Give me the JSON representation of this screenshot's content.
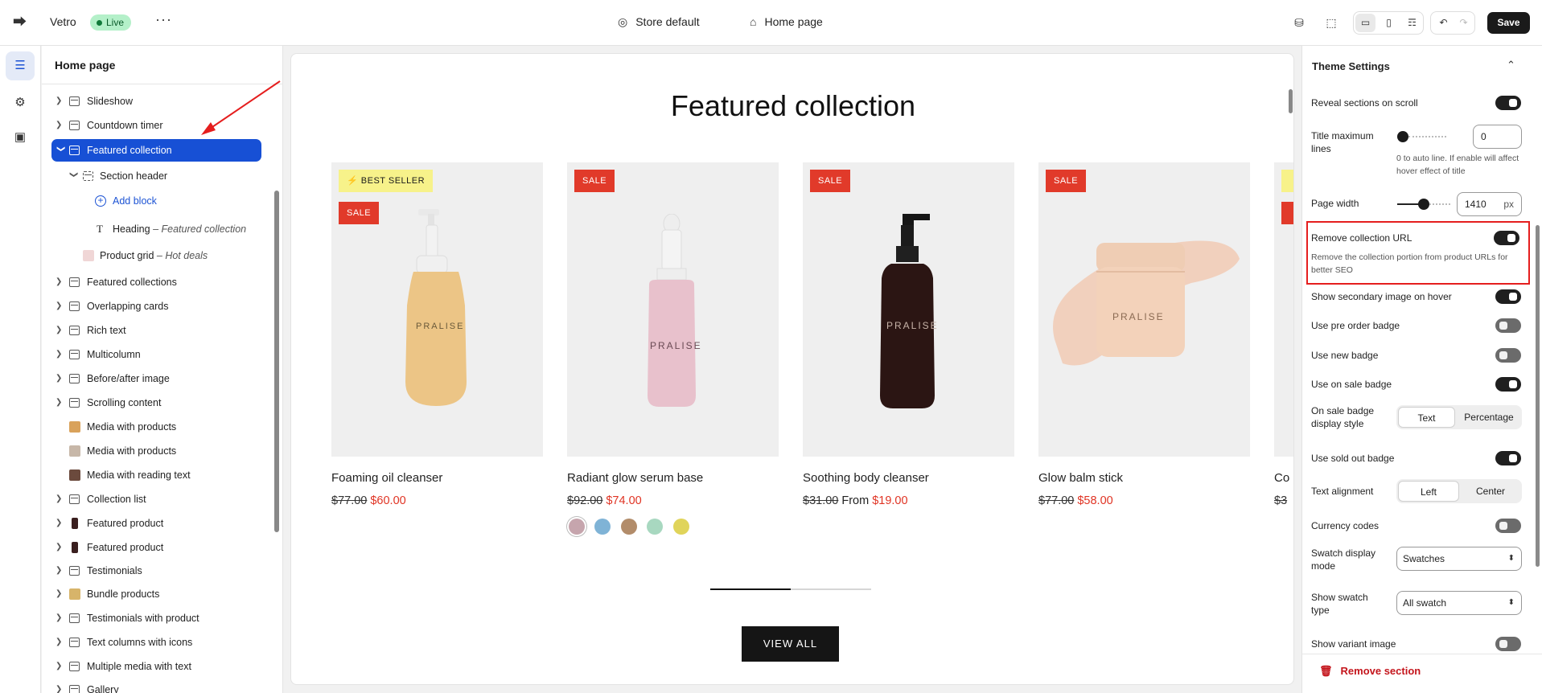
{
  "topbar": {
    "store_name": "Vetro",
    "status": "Live",
    "more": "···",
    "theme_label": "Store default",
    "page_label": "Home page",
    "save_label": "Save"
  },
  "sidebar": {
    "title": "Home page",
    "items": [
      {
        "label": "Slideshow"
      },
      {
        "label": "Countdown timer"
      },
      {
        "label": "Featured collection"
      },
      {
        "label": "Section header"
      },
      {
        "label": "Add block"
      },
      {
        "label": "Heading",
        "sub": "– Featured collection"
      },
      {
        "label": "Product grid",
        "sub": "– Hot deals"
      },
      {
        "label": "Featured collections"
      },
      {
        "label": "Overlapping cards"
      },
      {
        "label": "Rich text"
      },
      {
        "label": "Multicolumn"
      },
      {
        "label": "Before/after image"
      },
      {
        "label": "Scrolling content"
      },
      {
        "label": "Media with products"
      },
      {
        "label": "Media with products"
      },
      {
        "label": "Media with reading text"
      },
      {
        "label": "Collection list"
      },
      {
        "label": "Featured product"
      },
      {
        "label": "Featured product"
      },
      {
        "label": "Testimonials"
      },
      {
        "label": "Bundle products"
      },
      {
        "label": "Testimonials with product"
      },
      {
        "label": "Text columns with icons"
      },
      {
        "label": "Multiple media with text"
      },
      {
        "label": "Gallery"
      }
    ]
  },
  "preview": {
    "title": "Featured collection",
    "products": [
      {
        "name": "Foaming oil cleanser",
        "old_price": "$77.00",
        "price": "$60.00",
        "badges": [
          "BEST SELLER",
          "SALE"
        ],
        "brand": "PRALISE"
      },
      {
        "name": "Radiant glow serum base",
        "old_price": "$92.00",
        "price": "$74.00",
        "badges": [
          "SALE"
        ],
        "brand": "PRALISE",
        "swatches": [
          "#c6a5ad",
          "#7fb3d6",
          "#b28c6a",
          "#a8d8c0",
          "#e0d45a"
        ]
      },
      {
        "name": "Soothing body cleanser",
        "old_price": "$31.00",
        "from": "From",
        "price": "$19.00",
        "badges": [
          "SALE"
        ],
        "brand": "PRALISE"
      },
      {
        "name": "Glow balm stick",
        "old_price": "$77.00",
        "price": "$58.00",
        "badges": [
          "SALE"
        ],
        "brand": "PRALISE"
      },
      {
        "name": "Co",
        "old_price": "$3"
      }
    ],
    "view_all": "VIEW ALL",
    "slider_progress": 0.5
  },
  "settings": {
    "title": "Theme Settings",
    "reveal": {
      "label": "Reveal sections on scroll",
      "on": true
    },
    "title_max": {
      "label": "Title maximum lines",
      "value": "0",
      "help": "0 to auto line. If enable will affect hover effect of title"
    },
    "page_width": {
      "label": "Page width",
      "value": "1410",
      "unit": "px"
    },
    "remove_url": {
      "label": "Remove collection URL",
      "help": "Remove the collection portion from product URLs for better SEO",
      "on": true
    },
    "secondary_image": {
      "label": "Show secondary image on hover",
      "on": true
    },
    "pre_order": {
      "label": "Use pre order badge",
      "on": false
    },
    "new_badge": {
      "label": "Use new badge",
      "on": false
    },
    "sale_badge": {
      "label": "Use on sale badge",
      "on": true
    },
    "sale_style": {
      "label": "On sale badge display style",
      "options": [
        "Text",
        "Percentage"
      ],
      "selected": "Text"
    },
    "sold_out": {
      "label": "Use sold out badge",
      "on": true
    },
    "text_align": {
      "label": "Text alignment",
      "options": [
        "Left",
        "Center"
      ],
      "selected": "Left"
    },
    "currency": {
      "label": "Currency codes",
      "on": false
    },
    "swatch_mode": {
      "label": "Swatch display mode",
      "value": "Swatches"
    },
    "swatch_type": {
      "label": "Show swatch type",
      "value": "All swatch"
    },
    "variant_image": {
      "label": "Show variant image",
      "on": false
    },
    "remove_section": "Remove section"
  },
  "colors": {
    "accent": "#1750d5",
    "sale": "#e13a2a",
    "best_seller": "#f7f28a",
    "danger": "#c4151c",
    "highlight": "#e51e1e"
  }
}
